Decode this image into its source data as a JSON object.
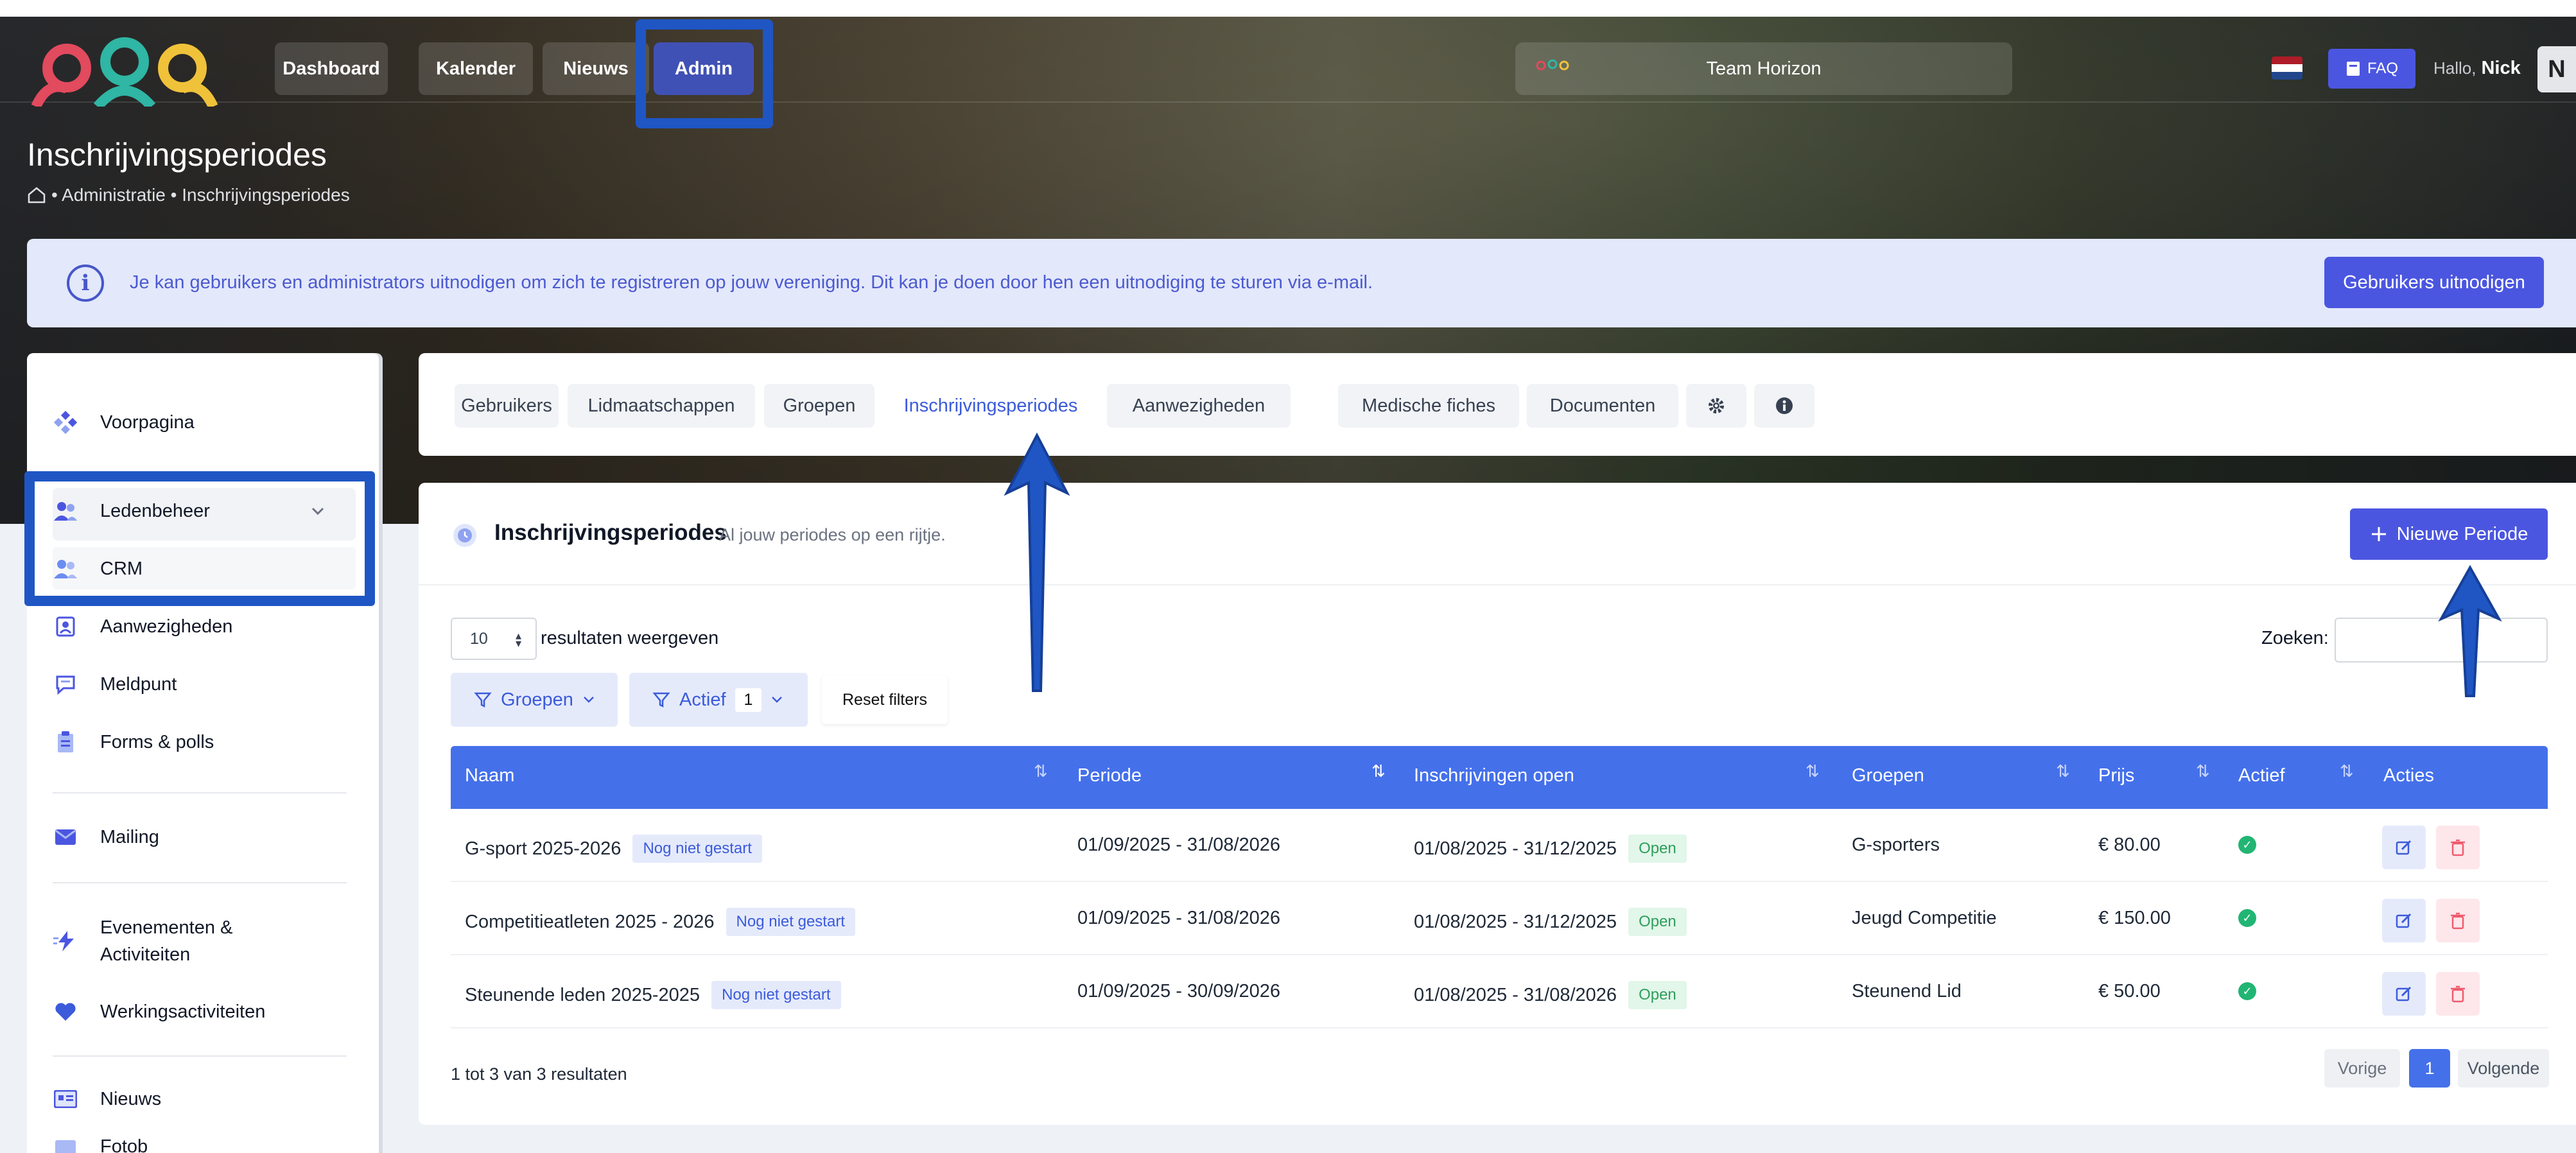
{
  "nav": {
    "links": [
      "Dashboard",
      "Kalender",
      "Nieuws",
      "Admin"
    ],
    "active": "Admin",
    "team_name": "Team Horizon",
    "faq_label": "FAQ",
    "greeting": "Hallo,",
    "user_name": "Nick",
    "avatar_initial": "N"
  },
  "page": {
    "title": "Inschrijvingsperiodes",
    "breadcrumb": "• Administratie • Inschrijvingsperiodes"
  },
  "info_banner": {
    "text": "Je kan gebruikers en administrators uitnodigen om zich te registreren op jouw vereniging. Dit kan je doen door hen een uitnodiging te sturen via e-mail.",
    "button": "Gebruikers uitnodigen"
  },
  "sidebar": {
    "items": [
      {
        "label": "Voorpagina",
        "icon": "diamond-icon"
      },
      {
        "label": "Ledenbeheer",
        "icon": "users-icon"
      },
      {
        "label": "CRM",
        "icon": "users-icon"
      },
      {
        "label": "Aanwezigheden",
        "icon": "badge-icon"
      },
      {
        "label": "Meldpunt",
        "icon": "chat-icon"
      },
      {
        "label": "Forms & polls",
        "icon": "clipboard-icon"
      },
      {
        "label": "Mailing",
        "icon": "mail-icon"
      },
      {
        "label": "Evenementen & Activiteiten",
        "icon": "bolt-icon"
      },
      {
        "label": "Werkingsactiviteiten",
        "icon": "heart-icon"
      },
      {
        "label": "Nieuws",
        "icon": "news-icon"
      },
      {
        "label": "Fotob",
        "icon": "photo-icon"
      }
    ]
  },
  "tabs": [
    "Gebruikers",
    "Lidmaatschappen",
    "Groepen",
    "Inschrijvingsperiodes",
    "Aanwezigheden",
    "Medische fiches",
    "Documenten"
  ],
  "active_tab": "Inschrijvingsperiodes",
  "card": {
    "title": "Inschrijvingsperiodes",
    "subtitle": "Al jouw periodes op een rijtje.",
    "new_button": "Nieuwe Periode",
    "page_size": "10",
    "page_size_label": "resultaten weergeven",
    "search_label": "Zoeken:",
    "search_value": "",
    "filter_groups": "Groepen",
    "filter_active": "Actief",
    "filter_active_count": "1",
    "reset_filters": "Reset filters"
  },
  "table": {
    "columns": [
      "Naam",
      "Periode",
      "Inschrijvingen open",
      "Groepen",
      "Prijs",
      "Actief",
      "Acties"
    ],
    "rows": [
      {
        "name": "G-sport 2025-2026",
        "status": "Nog niet gestart",
        "period": "01/09/2025 - 31/08/2026",
        "open": "01/08/2025 - 31/12/2025",
        "open_badge": "Open",
        "group": "G-sporters",
        "price": "€ 80.00"
      },
      {
        "name": "Competitieatleten 2025 - 2026",
        "status": "Nog niet gestart",
        "period": "01/09/2025 - 31/08/2026",
        "open": "01/08/2025 - 31/12/2025",
        "open_badge": "Open",
        "group": "Jeugd Competitie",
        "price": "€ 150.00"
      },
      {
        "name": "Steunende leden 2025-2025",
        "status": "Nog niet gestart",
        "period": "01/09/2025 - 30/09/2026",
        "open": "01/08/2025 - 31/08/2026",
        "open_badge": "Open",
        "group": "Steunend Lid",
        "price": "€ 50.00"
      }
    ]
  },
  "pagination": {
    "summary": "1 tot 3 van 3 resultaten",
    "prev": "Vorige",
    "current": "1",
    "next": "Volgende"
  },
  "colors": {
    "accent": "#4b56e0",
    "table_header": "#4470ea",
    "highlight": "#1f56c4"
  }
}
